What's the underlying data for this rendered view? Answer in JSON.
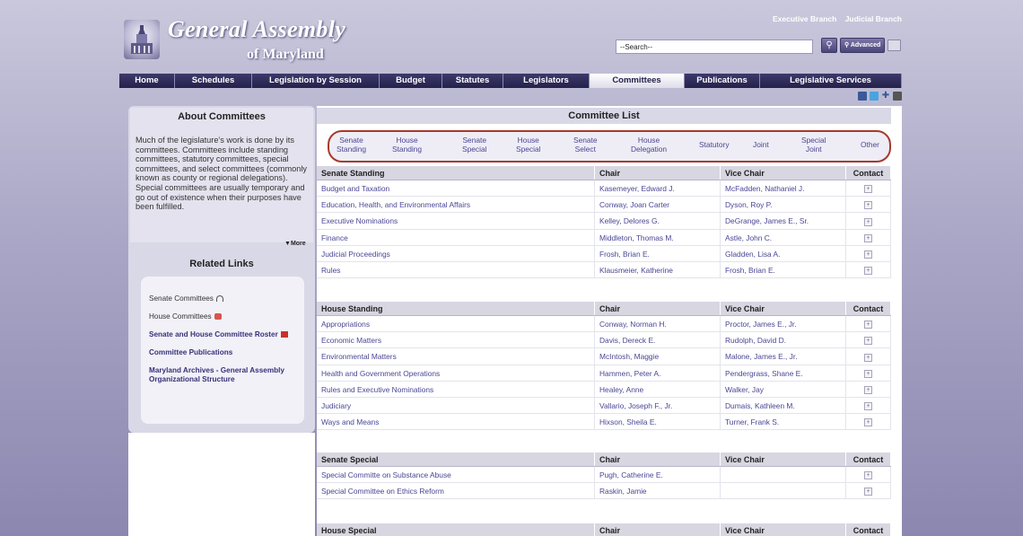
{
  "header": {
    "site_title": "General Assembly",
    "site_subtitle": "of Maryland",
    "branch_links": [
      "Executive Branch",
      "Judicial Branch"
    ],
    "search_placeholder": "--Search--",
    "advanced_label": "Advanced"
  },
  "nav": {
    "items": [
      {
        "label": "Home",
        "active": false
      },
      {
        "label": "Schedules",
        "active": false
      },
      {
        "label": "Legislation by Session",
        "active": false
      },
      {
        "label": "Budget",
        "active": false
      },
      {
        "label": "Statutes",
        "active": false
      },
      {
        "label": "Legislators",
        "active": false
      },
      {
        "label": "Committees",
        "active": true
      },
      {
        "label": "Publications",
        "active": false
      },
      {
        "label": "Legislative Services",
        "active": false
      }
    ]
  },
  "sidebar": {
    "about_title": "About Committees",
    "about_text": "Much of the legislature's work is done by its committees. Committees include standing committees, statutory committees, special committees, and select committees (commonly known as county or regional delegations). Special committees are usually temporary and go out of existence when their purposes have been fulfilled.",
    "more_label": "More",
    "related_title": "Related Links",
    "related_links": [
      "Senate Committees",
      "House Committees",
      "Senate and House Committee Roster",
      "Committee Publications",
      "Maryland Archives - General Assembly Organizational Structure"
    ]
  },
  "main": {
    "title": "Committee List",
    "filters": [
      {
        "line1": "Senate",
        "line2": "Standing"
      },
      {
        "line1": "House",
        "line2": "Standing"
      },
      {
        "line1": "Senate",
        "line2": "Special"
      },
      {
        "line1": "House",
        "line2": "Special"
      },
      {
        "line1": "Senate",
        "line2": "Select"
      },
      {
        "line1": "House",
        "line2": "Delegation"
      },
      {
        "line1": "Statutory",
        "line2": ""
      },
      {
        "line1": "Joint",
        "line2": ""
      },
      {
        "line1": "Special",
        "line2": "Joint"
      },
      {
        "line1": "Other",
        "line2": ""
      }
    ],
    "tables": [
      {
        "heading": "Senate Standing",
        "col_chair": "Chair",
        "col_vice": "Vice Chair",
        "col_contact": "Contact",
        "rows": [
          {
            "name": "Budget and Taxation",
            "chair": "Kasemeyer, Edward J.",
            "vice": "McFadden, Nathaniel J."
          },
          {
            "name": "Education, Health, and Environmental Affairs",
            "chair": "Conway, Joan Carter",
            "vice": "Dyson, Roy P."
          },
          {
            "name": "Executive Nominations",
            "chair": "Kelley, Delores G.",
            "vice": "DeGrange, James E., Sr."
          },
          {
            "name": "Finance",
            "chair": "Middleton, Thomas M.",
            "vice": "Astle, John C."
          },
          {
            "name": "Judicial Proceedings",
            "chair": "Frosh, Brian E.",
            "vice": "Gladden, Lisa A."
          },
          {
            "name": "Rules",
            "chair": "Klausmeier, Katherine",
            "vice": "Frosh, Brian E."
          }
        ]
      },
      {
        "heading": "House Standing",
        "col_chair": "Chair",
        "col_vice": "Vice Chair",
        "col_contact": "Contact",
        "rows": [
          {
            "name": "Appropriations",
            "chair": "Conway, Norman H.",
            "vice": "Proctor, James E., Jr."
          },
          {
            "name": "Economic Matters",
            "chair": "Davis, Dereck E.",
            "vice": "Rudolph, David D."
          },
          {
            "name": "Environmental Matters",
            "chair": "McIntosh, Maggie",
            "vice": "Malone, James E., Jr."
          },
          {
            "name": "Health and Government Operations",
            "chair": "Hammen, Peter A.",
            "vice": "Pendergrass, Shane E."
          },
          {
            "name": "Rules and Executive Nominations",
            "chair": "Healey, Anne",
            "vice": "Walker, Jay"
          },
          {
            "name": "Judiciary",
            "chair": "Vallario, Joseph F., Jr.",
            "vice": "Dumais, Kathleen M."
          },
          {
            "name": "Ways and Means",
            "chair": "Hixson, Sheila E.",
            "vice": "Turner, Frank S."
          }
        ]
      },
      {
        "heading": "Senate Special",
        "col_chair": "Chair",
        "col_vice": "Vice Chair",
        "col_contact": "Contact",
        "rows": [
          {
            "name": "Special Committe on Substance Abuse",
            "chair": "Pugh, Catherine E.",
            "vice": ""
          },
          {
            "name": "Special Committee on Ethics Reform",
            "chair": "Raskin, Jamie",
            "vice": ""
          }
        ]
      },
      {
        "heading": "House Special",
        "col_chair": "Chair",
        "col_vice": "Vice Chair",
        "col_contact": "Contact",
        "rows": []
      }
    ]
  }
}
